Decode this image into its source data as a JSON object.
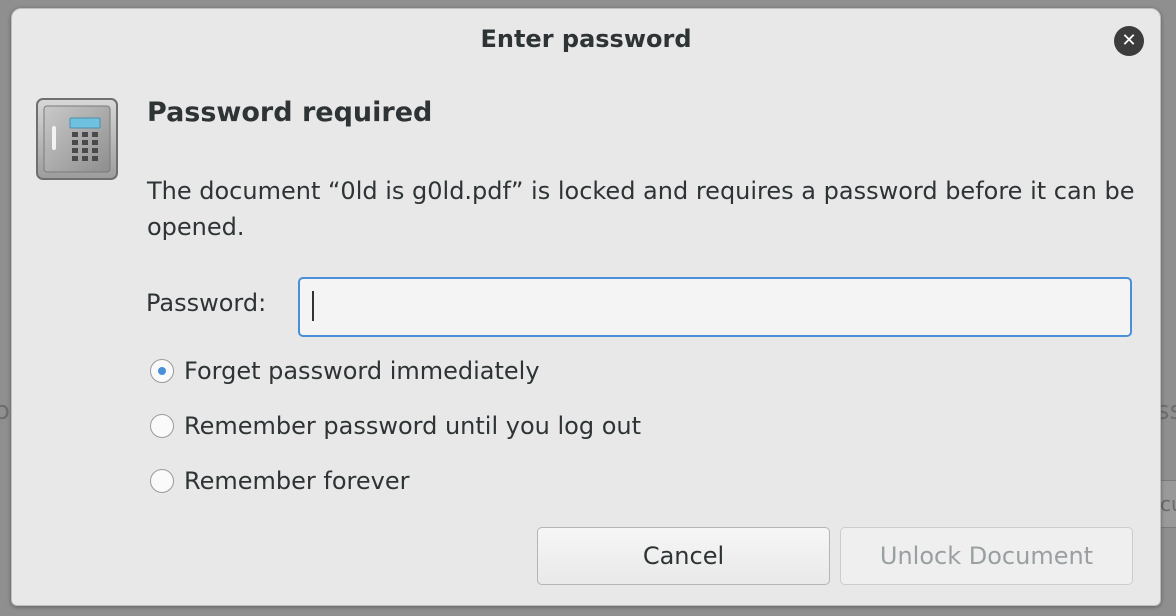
{
  "dialog": {
    "title": "Enter password",
    "heading": "Password required",
    "message": "The document “0ld is g0ld.pdf” is locked and requires a password before it can be opened.",
    "password_label": "Password:",
    "password_value": "",
    "options": [
      {
        "label": "Forget password immediately",
        "checked": true
      },
      {
        "label": "Remember password until you log out",
        "checked": false
      },
      {
        "label": "Remember forever",
        "checked": false
      }
    ],
    "cancel_label": "Cancel",
    "unlock_label": "Unlock Document",
    "unlock_enabled": false
  },
  "background": {
    "left_fragment": "o",
    "right_fragment": "ss",
    "button_fragment": "cu"
  },
  "colors": {
    "accent": "#4a90d9",
    "dialog_bg": "#e8e8e8",
    "text": "#2e3436",
    "disabled_text": "#9aa0a2"
  },
  "icons": {
    "dialog_icon": "safe-icon",
    "close": "close-icon"
  }
}
